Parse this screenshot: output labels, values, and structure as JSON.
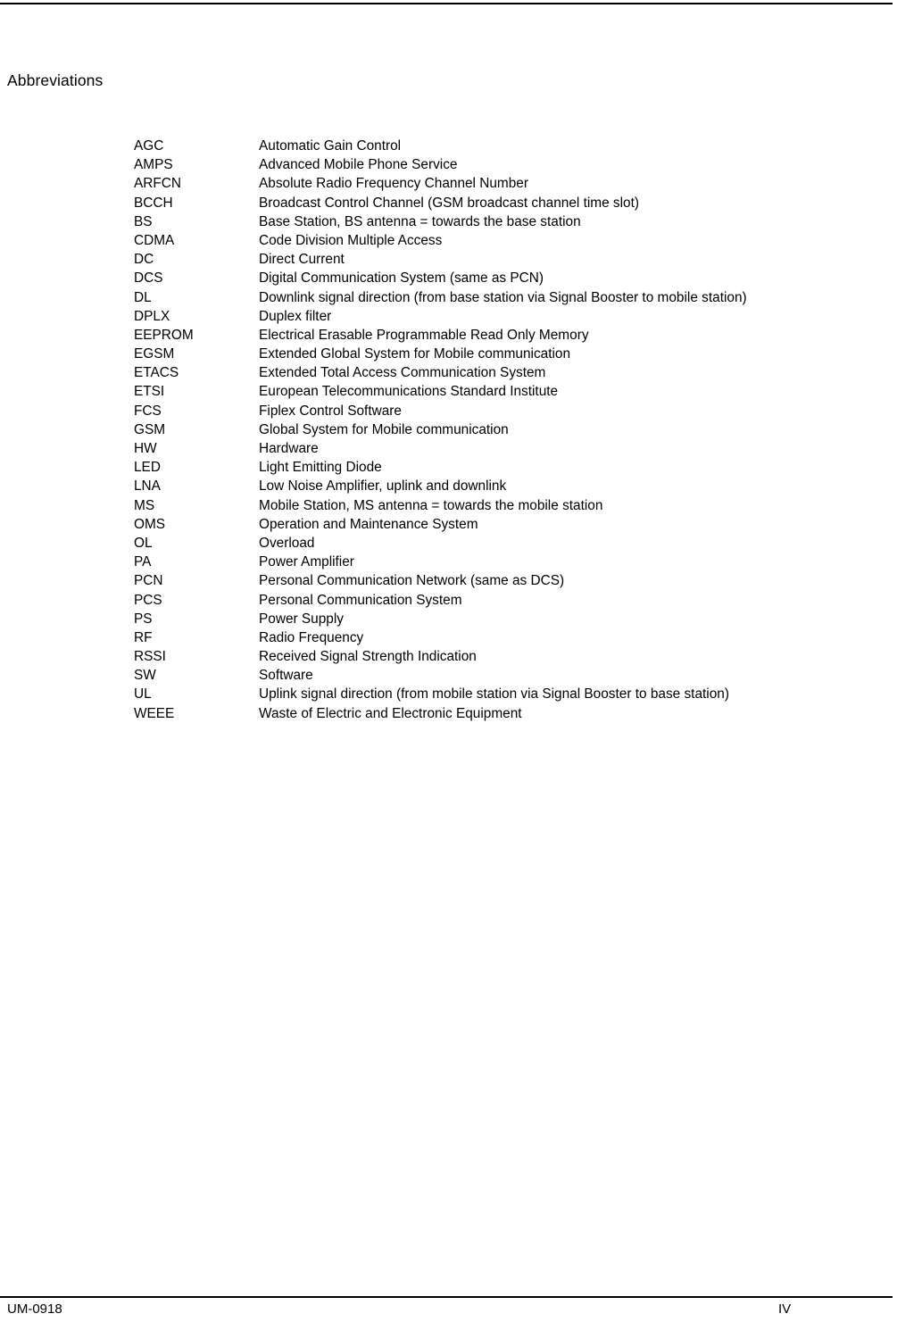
{
  "document": {
    "heading": "Abbreviations"
  },
  "abbreviations": [
    {
      "term": "AGC",
      "definition": "Automatic Gain Control"
    },
    {
      "term": "AMPS",
      "definition": "Advanced Mobile Phone Service"
    },
    {
      "term": "ARFCN",
      "definition": "Absolute Radio Frequency Channel Number"
    },
    {
      "term": "BCCH",
      "definition": "Broadcast Control Channel (GSM broadcast channel time slot)"
    },
    {
      "term": "BS",
      "definition": "Base Station, BS antenna = towards the base station"
    },
    {
      "term": "CDMA",
      "definition": "Code Division Multiple Access"
    },
    {
      "term": "DC",
      "definition": "Direct Current"
    },
    {
      "term": "DCS",
      "definition": "Digital Communication System (same as PCN)"
    },
    {
      "term": "DL",
      "definition": "Downlink signal direction (from base station via Signal Booster to mobile station)"
    },
    {
      "term": "DPLX",
      "definition": "Duplex filter"
    },
    {
      "term": "EEPROM",
      "definition": "Electrical Erasable Programmable Read Only Memory"
    },
    {
      "term": "EGSM",
      "definition": "Extended Global System for Mobile communication"
    },
    {
      "term": "ETACS",
      "definition": "Extended Total Access Communication System"
    },
    {
      "term": "ETSI",
      "definition": "European Telecommunications Standard Institute"
    },
    {
      "term": "FCS",
      "definition": "Fiplex Control Software"
    },
    {
      "term": "GSM",
      "definition": "Global System for Mobile communication"
    },
    {
      "term": "HW",
      "definition": "Hardware"
    },
    {
      "term": "LED",
      "definition": "Light Emitting Diode"
    },
    {
      "term": "LNA",
      "definition": "Low Noise Amplifier, uplink and downlink"
    },
    {
      "term": "MS",
      "definition": "Mobile Station, MS antenna = towards the mobile station"
    },
    {
      "term": "OMS",
      "definition": "Operation and Maintenance System"
    },
    {
      "term": "OL",
      "definition": "Overload"
    },
    {
      "term": "PA",
      "definition": "Power Amplifier"
    },
    {
      "term": "PCN",
      "definition": "Personal Communication Network (same as DCS)"
    },
    {
      "term": "PCS",
      "definition": "Personal Communication System"
    },
    {
      "term": "PS",
      "definition": "Power Supply"
    },
    {
      "term": "RF",
      "definition": "Radio Frequency"
    },
    {
      "term": "RSSI",
      "definition": "Received Signal Strength Indication"
    },
    {
      "term": "SW",
      "definition": "Software"
    },
    {
      "term": "UL",
      "definition": "Uplink signal direction (from mobile station via Signal Booster to base station)"
    },
    {
      "term": "WEEE",
      "definition": "Waste of Electric and Electronic Equipment"
    }
  ],
  "footer": {
    "document_id": "UM-0918",
    "page_number": "IV"
  }
}
